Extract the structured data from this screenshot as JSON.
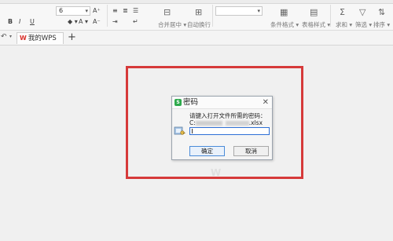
{
  "ribbon": {
    "font_size": "6",
    "buttons": {
      "bold": "B",
      "italic": "I",
      "underline": "U",
      "grow_font": "A⁺",
      "shrink_font": "A⁻",
      "fill": "◆ ▾",
      "font_color": "A ▾",
      "align_left": "≡",
      "align_center": "≣",
      "align_right": "☰",
      "indent": "⇥",
      "wrap": "↵"
    },
    "labels": {
      "merge_center": "合并居中 ▾",
      "auto_wrap": "自动换行",
      "conditional_format": "条件格式 ▾",
      "table_style": "表格样式 ▾",
      "sum": "求和 ▾",
      "filter": "筛选 ▾",
      "sort": "排序 ▾"
    }
  },
  "tabs": {
    "items": [
      {
        "label": "我的WPS",
        "logo": "W"
      }
    ],
    "add_label": "+"
  },
  "dialog": {
    "title": "密码",
    "close_label": "✕",
    "prompt": "请键入打开文件所需的密码：",
    "path_prefix": "C:",
    "path_suffix": ".xlsx",
    "password_value": "",
    "ok_label": "确定",
    "cancel_label": "取消"
  },
  "colors": {
    "highlight_border": "#d63a3a",
    "app_icon_green": "#2faa4d",
    "input_focus": "#2d6fd6"
  }
}
